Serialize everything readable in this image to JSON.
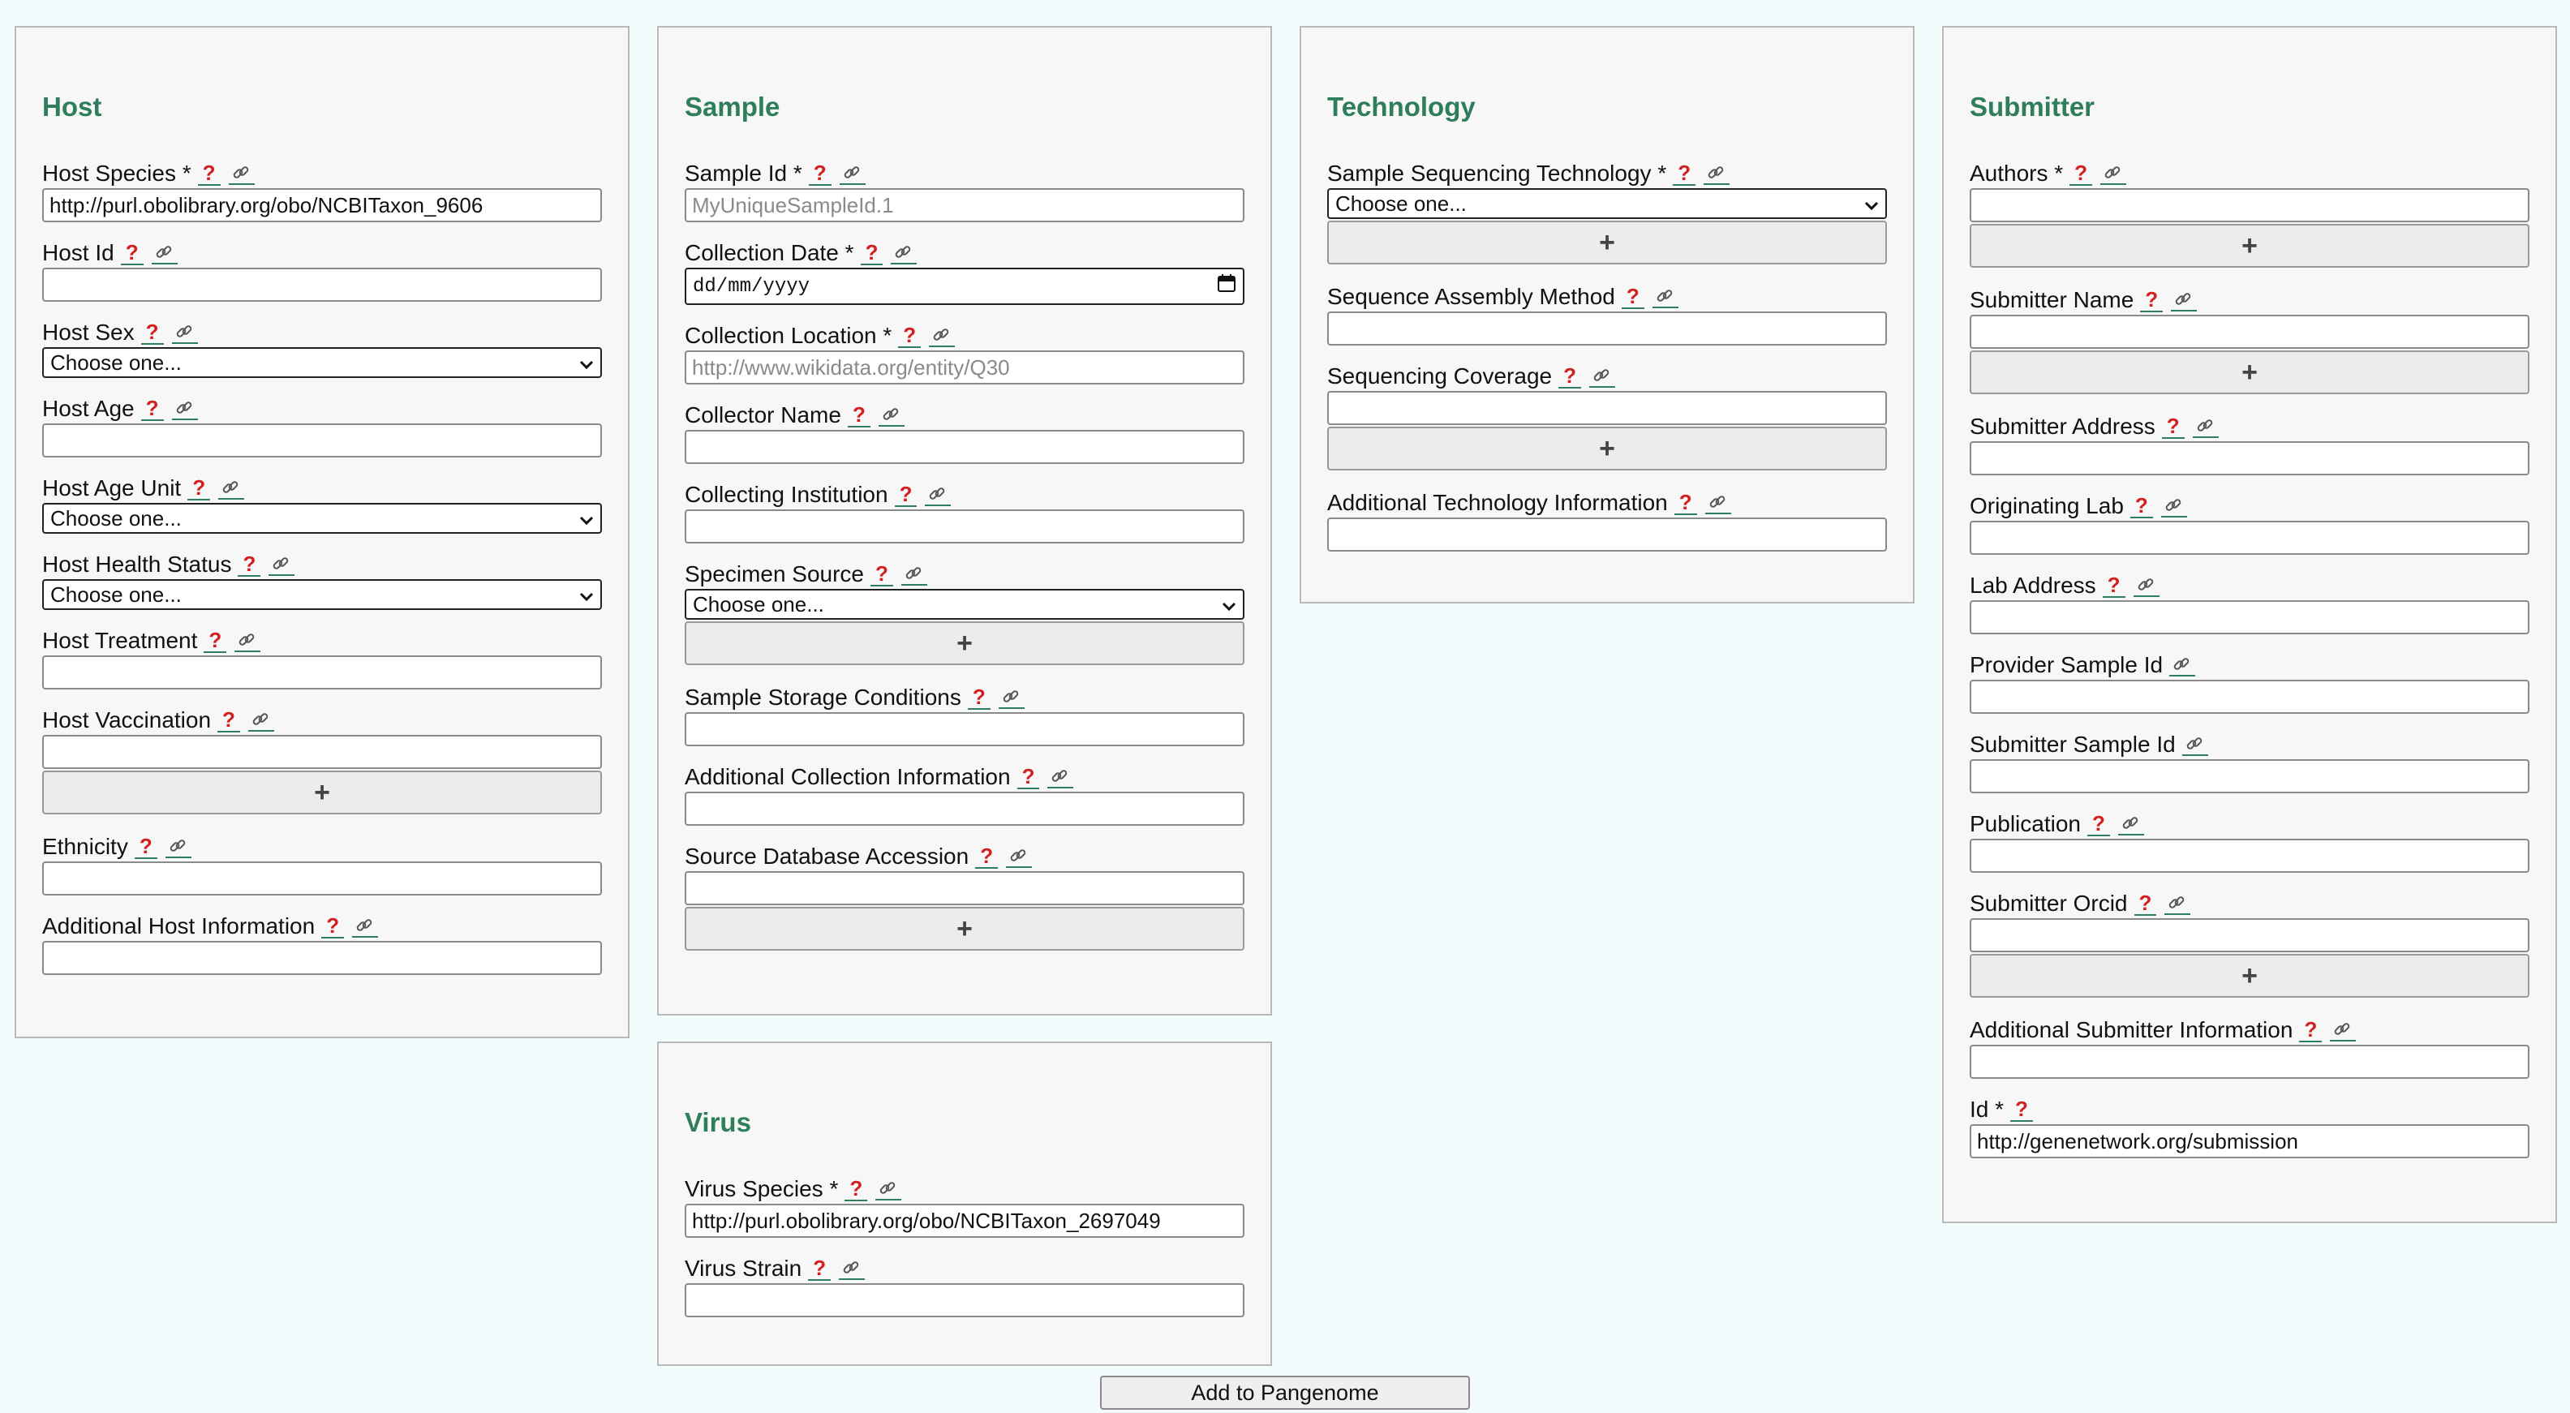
{
  "panels": {
    "host": {
      "title": "Host",
      "fields": [
        {
          "label": "Host Species *",
          "help": "?",
          "type": "input",
          "value": "http://purl.obolibrary.org/obo/NCBITaxon_9606"
        },
        {
          "label": "Host Id",
          "help": "?",
          "type": "input",
          "value": ""
        },
        {
          "label": "Host Sex",
          "help": "?",
          "type": "select",
          "value": "Choose one..."
        },
        {
          "label": "Host Age",
          "help": "?",
          "type": "input",
          "value": ""
        },
        {
          "label": "Host Age Unit",
          "help": "?",
          "type": "select",
          "value": "Choose one..."
        },
        {
          "label": "Host Health Status",
          "help": "?",
          "type": "select",
          "value": "Choose one..."
        },
        {
          "label": "Host Treatment",
          "help": "?",
          "type": "input",
          "value": ""
        },
        {
          "label": "Host Vaccination",
          "help": "?",
          "type": "input",
          "value": "",
          "plus": "+"
        },
        {
          "label": "Ethnicity",
          "help": "?",
          "type": "input",
          "value": ""
        },
        {
          "label": "Additional Host Information",
          "help": "?",
          "type": "input",
          "value": ""
        }
      ]
    },
    "sample": {
      "title": "Sample",
      "fields": [
        {
          "label": "Sample Id *",
          "help": "?",
          "type": "input",
          "value": "",
          "placeholder": "MyUniqueSampleId.1"
        },
        {
          "label": "Collection Date *",
          "help": "?",
          "type": "date",
          "value": "dd/mm/yyyy"
        },
        {
          "label": "Collection Location *",
          "help": "?",
          "type": "input",
          "value": "",
          "placeholder": "http://www.wikidata.org/entity/Q30"
        },
        {
          "label": "Collector Name",
          "help": "?",
          "type": "input",
          "value": ""
        },
        {
          "label": "Collecting Institution",
          "help": "?",
          "type": "input",
          "value": ""
        },
        {
          "label": "Specimen Source",
          "help": "?",
          "type": "select",
          "value": "Choose one...",
          "plus": "+"
        },
        {
          "label": "Sample Storage Conditions",
          "help": "?",
          "type": "input",
          "value": ""
        },
        {
          "label": "Additional Collection Information",
          "help": "?",
          "type": "input",
          "value": ""
        },
        {
          "label": "Source Database Accession",
          "help": "?",
          "type": "input",
          "value": "",
          "plus": "+"
        }
      ]
    },
    "virus": {
      "title": "Virus",
      "fields": [
        {
          "label": "Virus Species *",
          "help": "?",
          "type": "input",
          "value": "http://purl.obolibrary.org/obo/NCBITaxon_2697049"
        },
        {
          "label": "Virus Strain",
          "help": "?",
          "type": "input",
          "value": ""
        }
      ]
    },
    "technology": {
      "title": "Technology",
      "fields": [
        {
          "label": "Sample Sequencing Technology *",
          "help": "?",
          "type": "select",
          "value": "Choose one...",
          "plus": "+"
        },
        {
          "label": "Sequence Assembly Method",
          "help": "?",
          "type": "input",
          "value": ""
        },
        {
          "label": "Sequencing Coverage",
          "help": "?",
          "type": "input",
          "value": "",
          "plus": "+"
        },
        {
          "label": "Additional Technology Information",
          "help": "?",
          "type": "input",
          "value": ""
        }
      ]
    },
    "submitter": {
      "title": "Submitter",
      "fields": [
        {
          "label": "Authors *",
          "help": "?",
          "type": "input",
          "value": "",
          "plus": "+"
        },
        {
          "label": "Submitter Name",
          "help": "?",
          "type": "input",
          "value": "",
          "plus": "+"
        },
        {
          "label": "Submitter Address",
          "help": "?",
          "type": "input",
          "value": ""
        },
        {
          "label": "Originating Lab",
          "help": "?",
          "type": "input",
          "value": ""
        },
        {
          "label": "Lab Address",
          "help": "?",
          "type": "input",
          "value": ""
        },
        {
          "label": "Provider Sample Id",
          "help": "",
          "type": "input",
          "value": ""
        },
        {
          "label": "Submitter Sample Id",
          "help": "",
          "type": "input",
          "value": ""
        },
        {
          "label": "Publication",
          "help": "?",
          "type": "input",
          "value": ""
        },
        {
          "label": "Submitter Orcid",
          "help": "?",
          "type": "input",
          "value": "",
          "plus": "+"
        },
        {
          "label": "Additional Submitter Information",
          "help": "?",
          "type": "input",
          "value": ""
        },
        {
          "label": "Id *",
          "help": "?",
          "type": "input",
          "value": "http://genenetwork.org/submission",
          "nolink": true
        }
      ]
    }
  },
  "submit_label": "Add to Pangenome",
  "icons": {
    "help": "question-mark-icon",
    "link": "chain-link-icon",
    "select": "chevron-down-icon",
    "calendar": "calendar-icon"
  },
  "colors": {
    "heading": "#2e7d5b",
    "help": "#d21f1f",
    "background": "#f3fcfc",
    "panel": "#f7f7f7"
  }
}
